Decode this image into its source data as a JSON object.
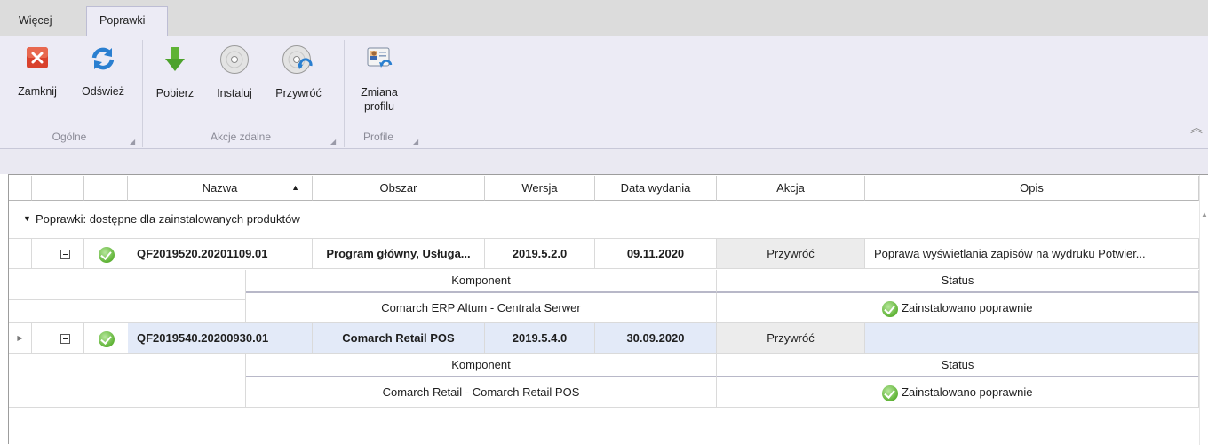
{
  "tabs": [
    {
      "label": "Więcej"
    },
    {
      "label": "Poprawki"
    }
  ],
  "ribbon": {
    "groups": [
      {
        "label": "Ogólne",
        "buttons": [
          {
            "label": "Zamknij",
            "icon": "close-icon"
          },
          {
            "label": "Odśwież",
            "icon": "refresh-icon"
          }
        ]
      },
      {
        "label": "Akcje zdalne",
        "buttons": [
          {
            "label": "Pobierz",
            "icon": "download-arrow-icon"
          },
          {
            "label": "Instaluj",
            "icon": "disc-icon"
          },
          {
            "label": "Przywróć",
            "icon": "disc-restore-icon"
          }
        ]
      },
      {
        "label": "Profile",
        "buttons": [
          {
            "label_line1": "Zmiana",
            "label_line2": "profilu",
            "icon": "profile-change-icon"
          }
        ]
      }
    ]
  },
  "grid": {
    "columns": [
      "Nazwa",
      "Obszar",
      "Wersja",
      "Data wydania",
      "Akcja",
      "Opis"
    ],
    "sort_indicator": "▲",
    "group_label": "Poprawki: dostępne dla zainstalowanych produktów",
    "sub_columns": [
      "Komponent",
      "Status"
    ],
    "rows": [
      {
        "nazwa": "QF2019520.20201109.01",
        "obszar": "Program główny, Usługa...",
        "wersja": "2019.5.2.0",
        "data": "09.11.2020",
        "akcja": "Przywróć",
        "opis": "Poprawa wyświetlania zapisów na wydruku Potwier...",
        "komponent": "Comarch ERP Altum - Centrala Serwer",
        "status": "Zainstalowano poprawnie"
      },
      {
        "nazwa": "QF2019540.20200930.01",
        "obszar": "Comarch Retail POS",
        "wersja": "2019.5.4.0",
        "data": "30.09.2020",
        "akcja": "Przywróć",
        "opis": "",
        "komponent": "Comarch Retail - Comarch Retail POS",
        "status": "Zainstalowano poprawnie"
      }
    ]
  },
  "colors": {
    "ribbon_bg": "#ecebf5",
    "selection": "#e3eaf8",
    "success": "#5fb336"
  }
}
